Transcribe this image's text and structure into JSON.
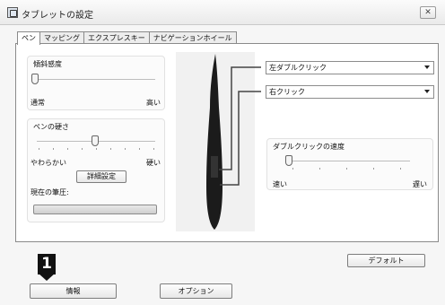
{
  "window": {
    "title": "タブレットの設定",
    "close_label": "✕"
  },
  "tabs": [
    "ペン",
    "マッピング",
    "エクスプレスキー",
    "ナビゲーションホイール"
  ],
  "tilt": {
    "title": "傾斜感度",
    "min_label": "通常",
    "max_label": "高い",
    "value": 0.0
  },
  "pen_tip": {
    "title": "ペンの硬さ",
    "min_label": "やわらかい",
    "max_label": "硬い",
    "value": 0.5,
    "detail_button": "詳細設定",
    "current_pressure_label": "現在の筆圧:"
  },
  "buttons": {
    "upper": "左ダブルクリック",
    "lower": "右クリック"
  },
  "double_click": {
    "title": "ダブルクリックの速度",
    "min_label": "速い",
    "max_label": "遅い",
    "value": 0.0
  },
  "default_button": "デフォルト",
  "footer": {
    "callout_number": "1",
    "info_button": "情報",
    "options_button": "オプション"
  }
}
